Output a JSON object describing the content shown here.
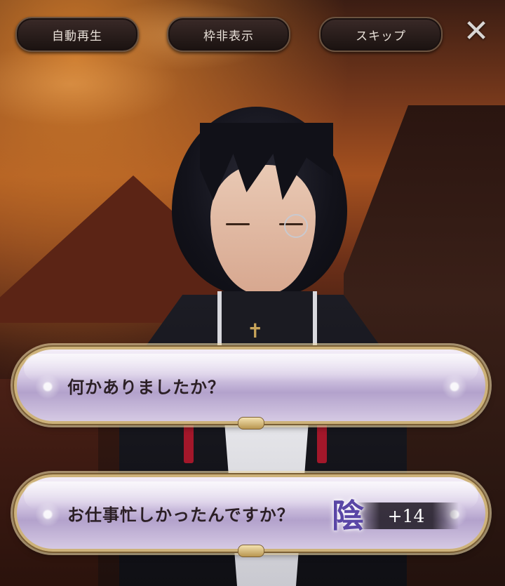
{
  "top_bar": {
    "auto_play_label": "自動再生",
    "hide_frame_label": "枠非表示",
    "skip_label": "スキップ",
    "close_symbol": "✕"
  },
  "choices": [
    {
      "text": "何かありましたか？"
    },
    {
      "text": "お仕事忙しかったんですか？",
      "badge_kanji": "陰",
      "bonus": "+14"
    }
  ],
  "colors": {
    "choice_fill": "#c9bddc",
    "choice_border_gold": "#cdb27a",
    "badge_color": "#5a46a6",
    "button_bg": "#241a18"
  },
  "icons": [
    "close-icon",
    "sakura-ornament-icon"
  ]
}
